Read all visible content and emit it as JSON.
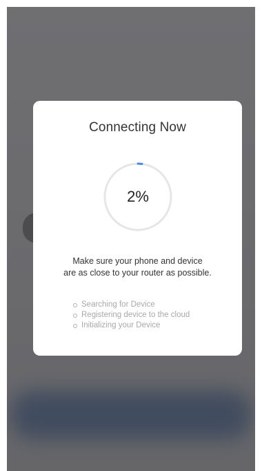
{
  "modal": {
    "title": "Connecting Now",
    "progress_percent": 2,
    "progress_text": "2%",
    "hint_line1": "Make sure your phone and device",
    "hint_line2": "are as close to your router as possible.",
    "steps": [
      {
        "label": "Searching for Device"
      },
      {
        "label": "Registering device to the cloud"
      },
      {
        "label": "Initializing your Device"
      }
    ]
  },
  "back_button": {
    "icon": "chevron-left-icon"
  },
  "colors": {
    "accent": "#4a86e8",
    "ring_track": "#e6e6e6",
    "overlay": "#6d6d70",
    "step_text": "#a8a8a8"
  }
}
